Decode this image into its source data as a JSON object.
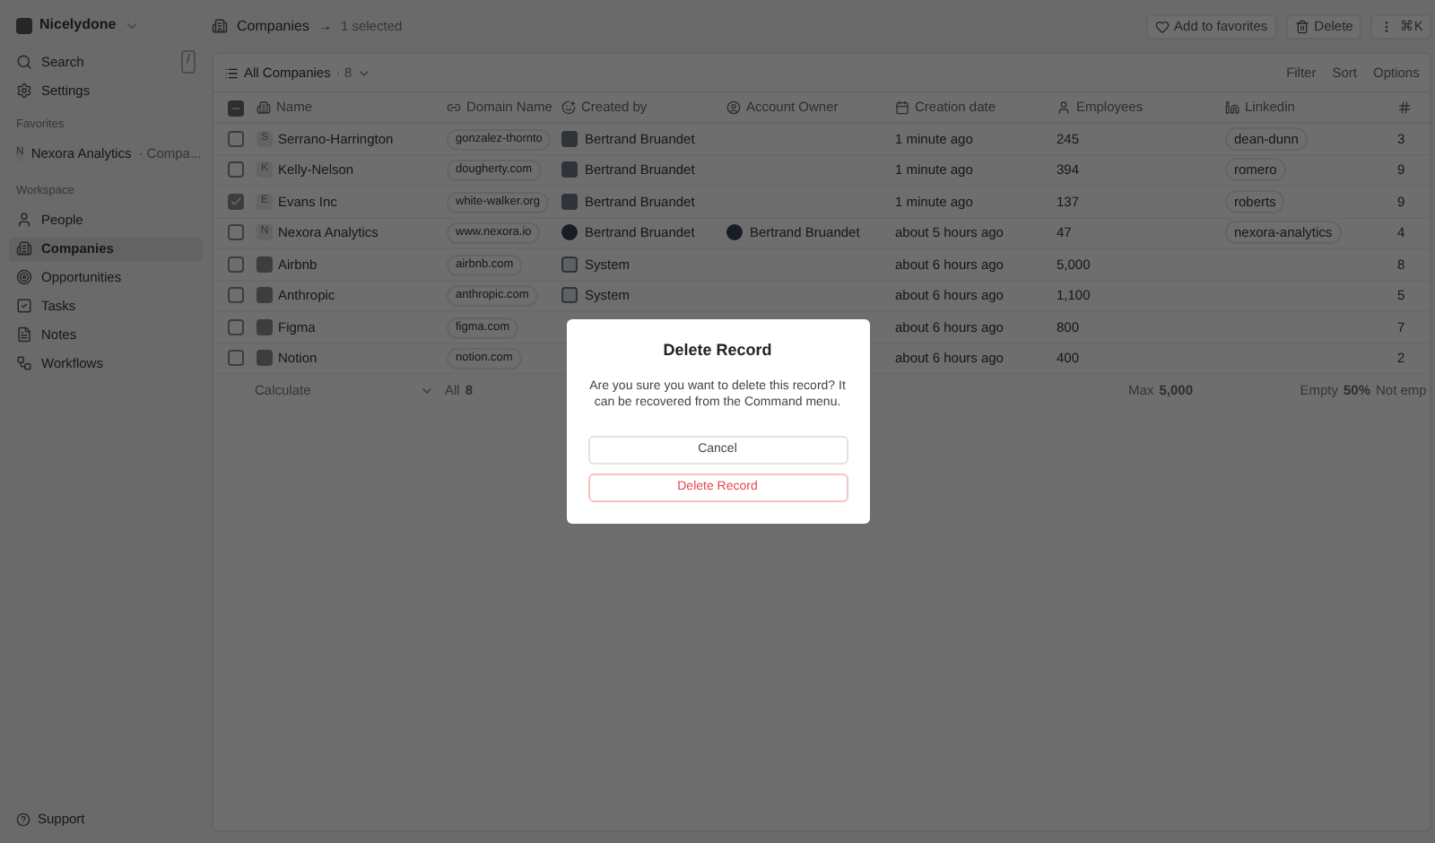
{
  "sidebar": {
    "workspace": "Nicelydone",
    "top_items": [
      {
        "label": "Search",
        "shortcut": "/"
      },
      {
        "label": "Settings"
      }
    ],
    "favorites": {
      "heading": "Favorites",
      "items": [
        {
          "label": "Nexora Analytics",
          "suffix": "· Compa...",
          "letter": "N"
        }
      ]
    },
    "workspace_section": {
      "heading": "Workspace",
      "items": [
        {
          "label": "People",
          "selected": false
        },
        {
          "label": "Companies",
          "selected": true
        },
        {
          "label": "Opportunities",
          "selected": false
        },
        {
          "label": "Tasks",
          "selected": false
        },
        {
          "label": "Notes",
          "selected": false
        },
        {
          "label": "Workflows",
          "selected": false
        }
      ]
    },
    "support": "Support"
  },
  "header": {
    "title": "Companies",
    "arrow": "→",
    "selection": "1 selected",
    "buttons": [
      "Add to favorites",
      "Delete",
      "⌘K"
    ]
  },
  "view": {
    "name": "All Companies",
    "count": "· 8",
    "actions": [
      "Filter",
      "Sort",
      "Options"
    ]
  },
  "table": {
    "select_all_indeterminate": true,
    "columns": [
      "Name",
      "Domain Name",
      "Created by",
      "Account Owner",
      "Creation date",
      "Employees",
      "Linkedin"
    ],
    "rows": [
      {
        "checked": false,
        "logo": "S",
        "name": "Serrano-Harrington",
        "domain": "gonzalez-thornto",
        "created_by": "Bertrand Bruandet",
        "kind": "person",
        "created": "1 minute ago",
        "employees": "245",
        "linkedin": "dean-dunn",
        "column_9": "3"
      },
      {
        "checked": false,
        "logo": "K",
        "name": "Kelly-Nelson",
        "domain": "dougherty.com",
        "created_by": "Bertrand Bruandet",
        "kind": "person",
        "created": "1 minute ago",
        "employees": "394",
        "linkedin": "romero",
        "column_9": "9"
      },
      {
        "checked": true,
        "logo": "E",
        "name": "Evans Inc",
        "domain": "white-walker.org",
        "created_by": "Bertrand Bruandet",
        "kind": "person",
        "created": "1 minute ago",
        "employees": "137",
        "linkedin": "roberts",
        "column_9": "9"
      },
      {
        "checked": false,
        "logo": "N",
        "name": "Nexora Analytics",
        "domain": "www.nexora.io",
        "created_by": "Bertrand Bruandet",
        "kind": "avatar",
        "account_owner": "Bertrand Bruandet",
        "created": "about 5 hours ago",
        "employees": "47",
        "linkedin": "nexora-analytics",
        "column_9": "4"
      },
      {
        "checked": false,
        "logo": "",
        "name": "Airbnb",
        "domain": "airbnb.com",
        "created_by": "System",
        "kind": "system",
        "created": "about 6 hours ago",
        "employees": "5,000",
        "column_9": "8"
      },
      {
        "checked": false,
        "logo": "",
        "name": "Anthropic",
        "domain": "anthropic.com",
        "created_by": "System",
        "kind": "system",
        "created": "about 6 hours ago",
        "employees": "1,100",
        "column_9": "5"
      },
      {
        "checked": false,
        "logo": "",
        "name": "Figma",
        "domain": "figma.com",
        "created": "about 6 hours ago",
        "employees": "800",
        "column_9": "7"
      },
      {
        "checked": false,
        "logo": "",
        "name": "Notion",
        "domain": "notion.com",
        "created": "about 6 hours ago",
        "employees": "400",
        "column_9": "2"
      }
    ],
    "footer": {
      "calculate": "Calculate",
      "all_label": "All",
      "all_value": "8",
      "max_label": "Max",
      "max_value": "5,000",
      "empty_label": "Empty",
      "empty_value": "50%",
      "last": "Not emp"
    }
  },
  "dialog": {
    "title": "Delete Record",
    "message": "Are you sure you want to delete this record? It can be recovered from the Command menu.",
    "buttons": [
      {
        "label": "Cancel",
        "kind": "neutral"
      },
      {
        "label": "Delete Record",
        "kind": "danger"
      }
    ]
  }
}
